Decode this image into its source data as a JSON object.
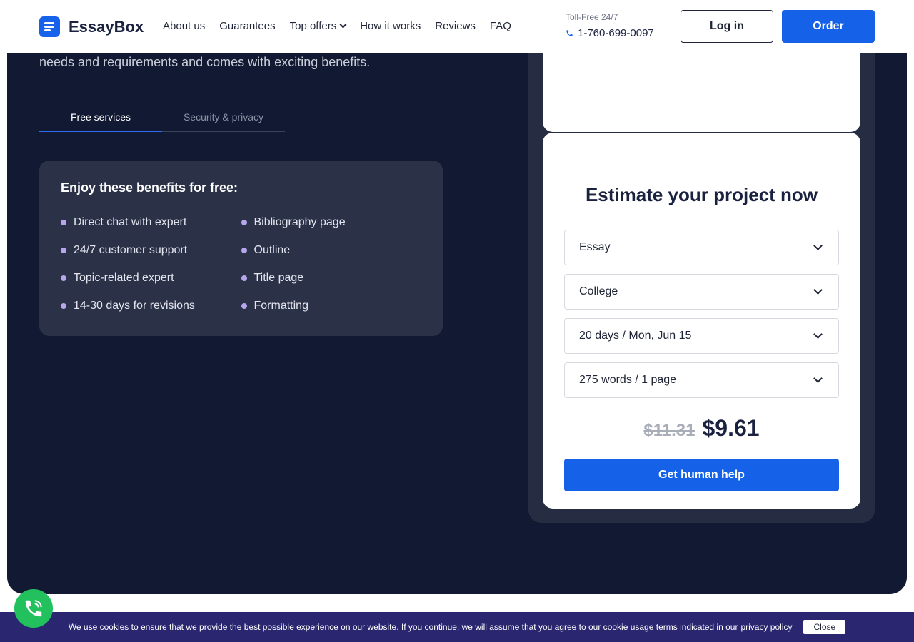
{
  "header": {
    "logo_text": "EssayBox",
    "nav": [
      {
        "label": "About us"
      },
      {
        "label": "Guarantees"
      },
      {
        "label": "Top offers",
        "has_dropdown": true
      },
      {
        "label": "How it works"
      },
      {
        "label": "Reviews"
      },
      {
        "label": "FAQ"
      }
    ],
    "phone_label": "Toll-Free 24/7",
    "phone_number": "1-760-699-0097",
    "login_label": "Log in",
    "order_label": "Order"
  },
  "intro": {
    "text": "needs and requirements and comes with exciting benefits."
  },
  "tabs": [
    {
      "label": "Free services",
      "active": true
    },
    {
      "label": "Security & privacy",
      "active": false
    }
  ],
  "benefits": {
    "title": "Enjoy these benefits for free:",
    "col1": [
      "Direct chat with expert",
      "24/7 customer support",
      "Topic-related expert",
      "14-30 days for revisions"
    ],
    "col2": [
      "Bibliography page",
      "Outline",
      "Title page",
      "Formatting"
    ]
  },
  "estimate": {
    "title": "Estimate your project now",
    "paper_type": "Essay",
    "academic_level": "College",
    "deadline": "20 days / Mon, Jun 15",
    "length": "275 words / 1 page",
    "old_price": "$11.31",
    "new_price": "$9.61",
    "cta_label": "Get human help"
  },
  "cookie": {
    "text": "We use cookies to ensure that we provide the best possible experience on our website. If you continue, we will assume that you agree to our cookie usage terms indicated in our",
    "link_label": "privacy policy",
    "close_label": "Close"
  },
  "colors": {
    "dark_bg": "#121a33",
    "panel": "#262c41",
    "card": "#2b3147",
    "accent": "#1562e8",
    "call": "#22c15e",
    "cookie_bg": "#2a2670"
  },
  "icons": [
    "logo-icon",
    "chevron-down-icon",
    "phone-icon",
    "call-icon"
  ]
}
